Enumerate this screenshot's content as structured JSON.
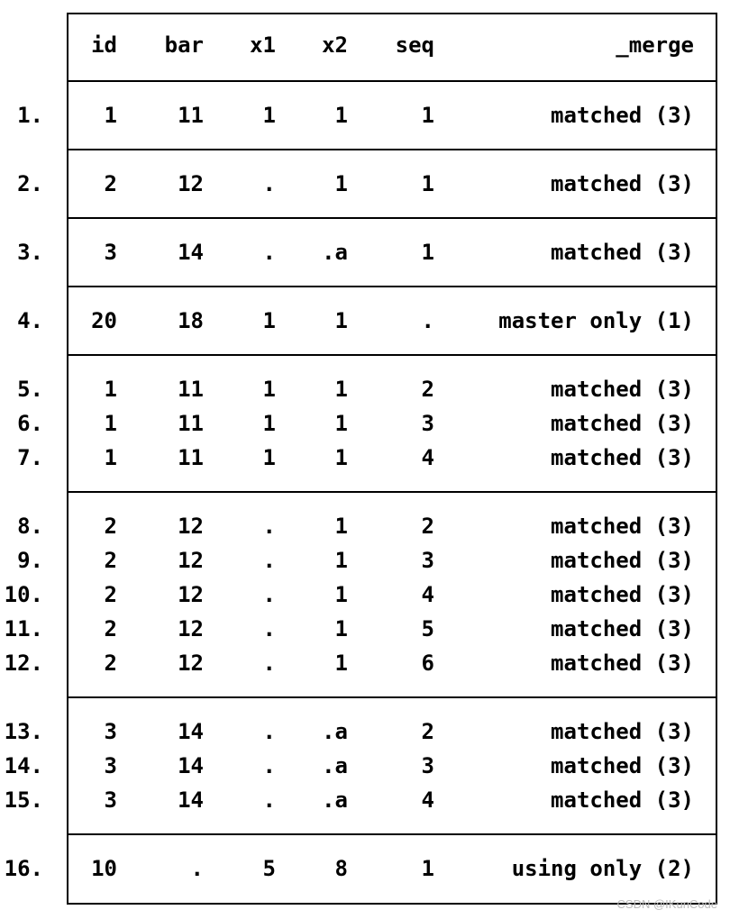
{
  "columns": [
    "id",
    "bar",
    "x1",
    "x2",
    "seq",
    "_merge"
  ],
  "groups": [
    [
      [
        "1.",
        "1",
        "11",
        "1",
        "1",
        "1",
        "matched (3)"
      ]
    ],
    [
      [
        "2.",
        "2",
        "12",
        ".",
        "1",
        "1",
        "matched (3)"
      ]
    ],
    [
      [
        "3.",
        "3",
        "14",
        ".",
        ".a",
        "1",
        "matched (3)"
      ]
    ],
    [
      [
        "4.",
        "20",
        "18",
        "1",
        "1",
        ".",
        "master only (1)"
      ]
    ],
    [
      [
        "5.",
        "1",
        "11",
        "1",
        "1",
        "2",
        "matched (3)"
      ],
      [
        "6.",
        "1",
        "11",
        "1",
        "1",
        "3",
        "matched (3)"
      ],
      [
        "7.",
        "1",
        "11",
        "1",
        "1",
        "4",
        "matched (3)"
      ]
    ],
    [
      [
        "8.",
        "2",
        "12",
        ".",
        "1",
        "2",
        "matched (3)"
      ],
      [
        "9.",
        "2",
        "12",
        ".",
        "1",
        "3",
        "matched (3)"
      ],
      [
        "10.",
        "2",
        "12",
        ".",
        "1",
        "4",
        "matched (3)"
      ],
      [
        "11.",
        "2",
        "12",
        ".",
        "1",
        "5",
        "matched (3)"
      ],
      [
        "12.",
        "2",
        "12",
        ".",
        "1",
        "6",
        "matched (3)"
      ]
    ],
    [
      [
        "13.",
        "3",
        "14",
        ".",
        ".a",
        "2",
        "matched (3)"
      ],
      [
        "14.",
        "3",
        "14",
        ".",
        ".a",
        "3",
        "matched (3)"
      ],
      [
        "15.",
        "3",
        "14",
        ".",
        ".a",
        "4",
        "matched (3)"
      ]
    ],
    [
      [
        "16.",
        "10",
        ".",
        "5",
        "8",
        "1",
        "using only (2)"
      ]
    ]
  ],
  "watermark": "CSDN @IKunCode"
}
